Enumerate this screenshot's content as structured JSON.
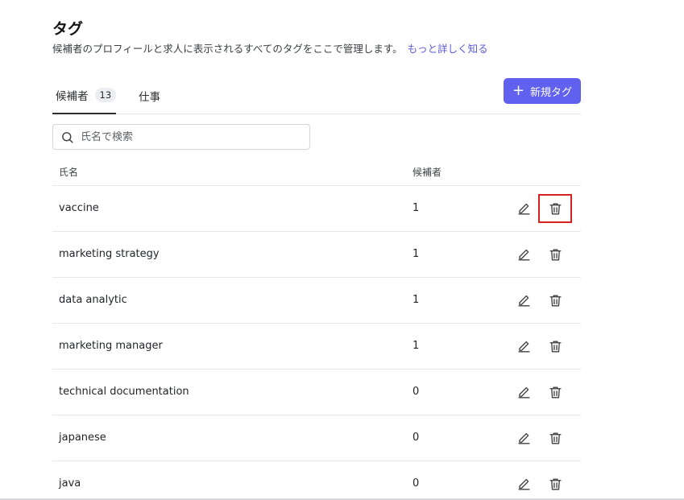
{
  "header": {
    "title": "タグ",
    "description": "候補者のプロフィールと求人に表示されるすべてのタグをここで管理します。",
    "learn_more": "もっと詳しく知る"
  },
  "tabs": [
    {
      "label": "候補者",
      "count": "13",
      "active": true
    },
    {
      "label": "仕事",
      "active": false
    }
  ],
  "new_tag_button": {
    "label": "新規タグ",
    "icon": "plus-icon"
  },
  "search": {
    "placeholder": "氏名で検索",
    "value": ""
  },
  "table": {
    "columns": [
      "氏名",
      "候補者"
    ],
    "rows": [
      {
        "name": "vaccine",
        "count": "1"
      },
      {
        "name": "marketing strategy",
        "count": "1"
      },
      {
        "name": "data analytic",
        "count": "1"
      },
      {
        "name": "marketing manager",
        "count": "1"
      },
      {
        "name": "technical documentation",
        "count": "0"
      },
      {
        "name": "japanese",
        "count": "0"
      },
      {
        "name": "java",
        "count": "0"
      }
    ]
  },
  "colors": {
    "accent": "#6161f0",
    "link": "#5b5bd6",
    "highlight": "#d61f1f"
  },
  "icons": {
    "search": "search-icon",
    "edit": "pencil-icon",
    "delete": "trash-icon"
  }
}
